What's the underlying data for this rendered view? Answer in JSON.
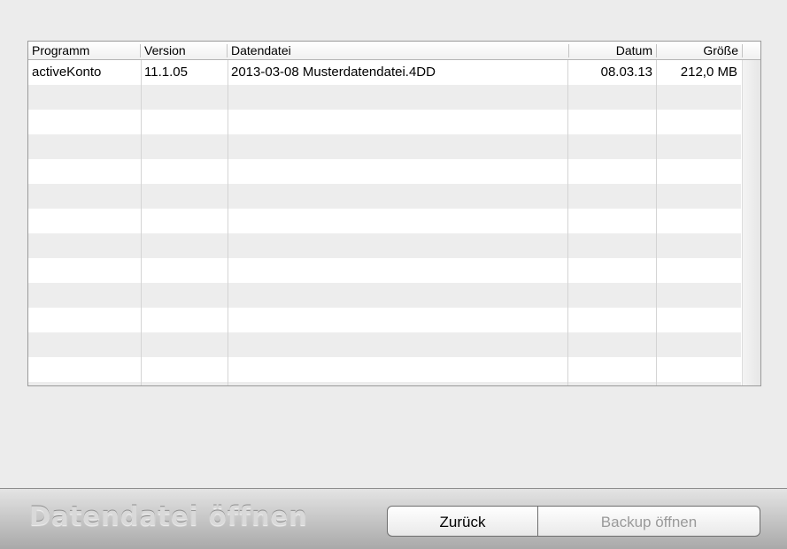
{
  "table": {
    "columns": [
      {
        "label": "Programm",
        "align": "left"
      },
      {
        "label": "Version",
        "align": "left"
      },
      {
        "label": "Datendatei",
        "align": "left"
      },
      {
        "label": "Datum",
        "align": "right"
      },
      {
        "label": "Größe",
        "align": "right"
      }
    ],
    "rows": [
      [
        "activeKonto",
        "11.1.05",
        "2013-03-08 Musterdatendatei.4DD",
        "08.03.13",
        "212,0 MB"
      ]
    ],
    "empty_row_count": 13
  },
  "footer": {
    "title": "Datendatei öffnen",
    "back_label": "Zurück",
    "open_backup_label": "Backup öffnen"
  },
  "colors": {
    "window_bg": "#ececec",
    "stripe": "#ededed",
    "disabled_text": "#9a9a9a"
  }
}
